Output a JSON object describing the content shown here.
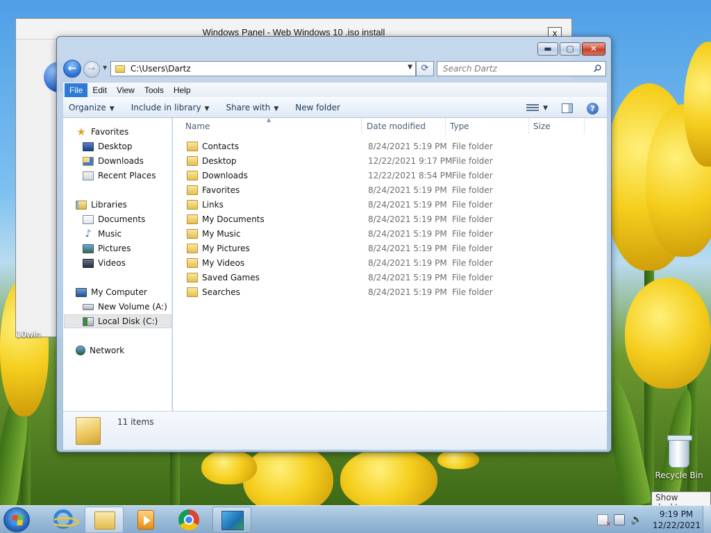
{
  "background_window": {
    "title": "Windows Panel - Web Windows 10 .iso install",
    "close_label": "x",
    "desktop_label": "10win"
  },
  "explorer": {
    "address": "C:\\Users\\Dartz",
    "search_placeholder": "Search Dartz",
    "window_buttons": {
      "min": "▬",
      "max": "▢",
      "close": "✕"
    },
    "menu": [
      "File",
      "Edit",
      "View",
      "Tools",
      "Help"
    ],
    "active_menu": "File",
    "toolbar": {
      "organize": "Organize",
      "include_in_library": "Include in library",
      "share_with": "Share with",
      "new_folder": "New folder"
    },
    "nav": {
      "favorites": "Favorites",
      "favorites_items": [
        "Desktop",
        "Downloads",
        "Recent Places"
      ],
      "libraries": "Libraries",
      "libraries_items": [
        "Documents",
        "Music",
        "Pictures",
        "Videos"
      ],
      "computer": "My Computer",
      "computer_items": [
        "New Volume (A:)",
        "Local Disk (C:)"
      ],
      "selected_item": "Local Disk (C:)",
      "network": "Network"
    },
    "columns": [
      "Name",
      "Date modified",
      "Type",
      "Size"
    ],
    "files": [
      {
        "name": "Contacts",
        "date": "8/24/2021 5:19 PM",
        "type": "File folder"
      },
      {
        "name": "Desktop",
        "date": "12/22/2021 9:17 PM",
        "type": "File folder"
      },
      {
        "name": "Downloads",
        "date": "12/22/2021 8:54 PM",
        "type": "File folder"
      },
      {
        "name": "Favorites",
        "date": "8/24/2021 5:19 PM",
        "type": "File folder"
      },
      {
        "name": "Links",
        "date": "8/24/2021 5:19 PM",
        "type": "File folder"
      },
      {
        "name": "My Documents",
        "date": "8/24/2021 5:19 PM",
        "type": "File folder"
      },
      {
        "name": "My Music",
        "date": "8/24/2021 5:19 PM",
        "type": "File folder"
      },
      {
        "name": "My Pictures",
        "date": "8/24/2021 5:19 PM",
        "type": "File folder"
      },
      {
        "name": "My Videos",
        "date": "8/24/2021 5:19 PM",
        "type": "File folder"
      },
      {
        "name": "Saved Games",
        "date": "8/24/2021 5:19 PM",
        "type": "File folder"
      },
      {
        "name": "Searches",
        "date": "8/24/2021 5:19 PM",
        "type": "File folder"
      }
    ],
    "status": "11 items"
  },
  "desktop": {
    "recycle_bin": "Recycle Bin",
    "tooltip": "Show desktop"
  },
  "taskbar": {
    "apps": [
      "internet-explorer",
      "windows-explorer",
      "media-player",
      "chrome",
      "windows-panel"
    ],
    "time": "9:19 PM",
    "date": "12/22/2021"
  },
  "colors": {
    "menu_active": "#2e7ad8",
    "close_button": "#c03a22"
  }
}
